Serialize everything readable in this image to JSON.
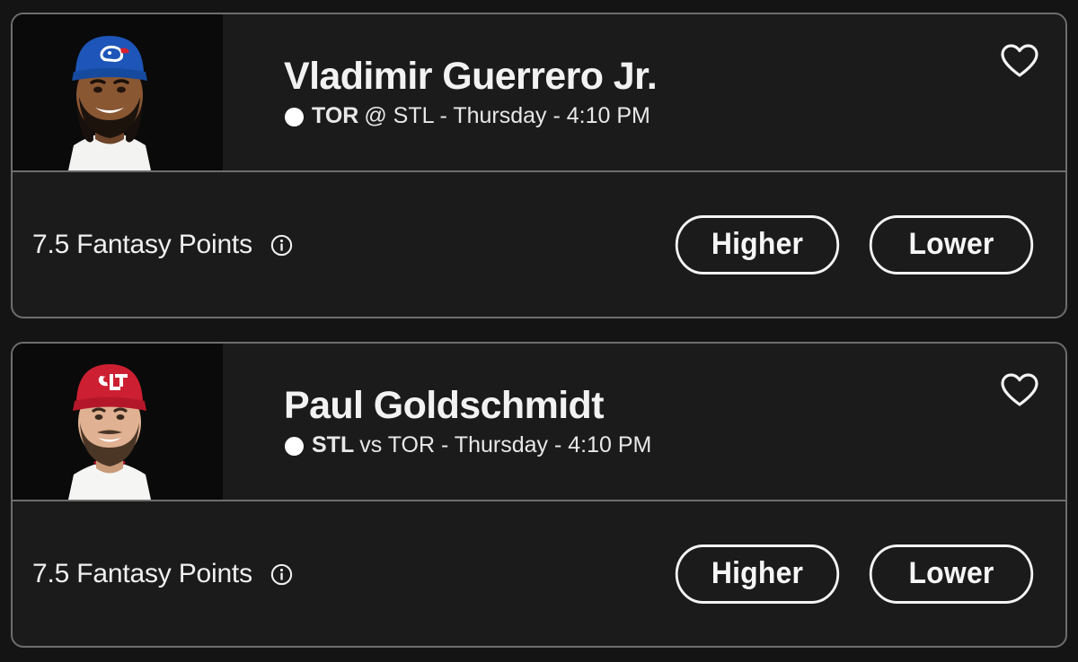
{
  "app": {
    "background_color": "#141414",
    "card_background_color": "#1b1b1b",
    "card_border_color": "#6e6e6e",
    "text_color": "#f2f2f2"
  },
  "cards": [
    {
      "player_name": "Vladimir Guerrero Jr.",
      "team_abbr": "TOR",
      "matchup": "@ STL - Thursday - 4:10 PM",
      "sport_icon": "baseball-icon",
      "favorite_icon": "heart-icon",
      "favorited": false,
      "stat_line": "7.5 Fantasy Points",
      "stat_value": "7.5",
      "stat_name": "Fantasy Points",
      "info_icon": "info-icon",
      "higher_label": "Higher",
      "lower_label": "Lower",
      "stripe_color_a": "#ee2b24",
      "stripe_color_b": "#1f6fd0"
    },
    {
      "player_name": "Paul Goldschmidt",
      "team_abbr": "STL",
      "matchup": "vs TOR - Thursday - 4:10 PM",
      "sport_icon": "baseball-icon",
      "favorite_icon": "heart-icon",
      "favorited": false,
      "stat_line": "7.5 Fantasy Points",
      "stat_value": "7.5",
      "stat_name": "Fantasy Points",
      "info_icon": "info-icon",
      "higher_label": "Higher",
      "lower_label": "Lower",
      "stripe_color_a": "#0e2a6b",
      "stripe_color_b": "#c8203f"
    }
  ]
}
